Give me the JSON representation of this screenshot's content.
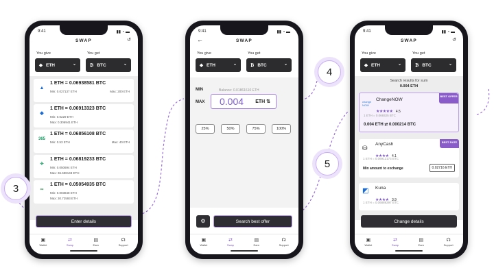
{
  "common": {
    "time": "9:41",
    "title": "SWAP",
    "you_give": "You give",
    "you_get": "You get",
    "give": "ETH",
    "get": "BTC",
    "nav": [
      {
        "icon": "wallet-icon",
        "label": "Wallet"
      },
      {
        "icon": "swap-icon",
        "label": "Swap"
      },
      {
        "icon": "earn-icon",
        "label": "Earn"
      },
      {
        "icon": "support-icon",
        "label": "Support"
      }
    ]
  },
  "screen1": {
    "offers": [
      {
        "logo": "▲",
        "rate": "1 ETH = 0.06938581 BTC",
        "min": "Min: 0.027137 ETH",
        "max": "Max: 200 ETH"
      },
      {
        "logo": "◆",
        "rate": "1 ETH = 0.06913323 BTC",
        "min": "Min: 0.0229 ETH",
        "max2": "Max: 0.306941 ETH"
      },
      {
        "logo": "365",
        "rate": "1 ETH = 0.06856108 BTC",
        "min": "Min: 0.53 ETH",
        "max": "Max: 40 ETH"
      },
      {
        "logo": "✈",
        "rate": "1 ETH = 0.06819233 BTC",
        "min": "Min: 0.050694 ETH",
        "max2": "Max: 36.698148 ETH"
      },
      {
        "logo": "∞",
        "rate": "1 ETH = 0.05054935 BTC",
        "min": "Min: 0.003848 ETH",
        "max2": "Max: 30.72593 ETH"
      }
    ],
    "button": "Enter details"
  },
  "screen2": {
    "min": "MIN",
    "max": "MAX",
    "balance": "Balance: 0.01861610 ETH",
    "amount": "0.004",
    "unit": "ETH ⇅",
    "pcts": [
      "25%",
      "50%",
      "75%",
      "100%"
    ],
    "button": "Search best offer"
  },
  "screen3": {
    "heading": "Search results for sum",
    "sum": "0.004 ETH",
    "r1": {
      "name": "ChangeNOW",
      "score": "4.5",
      "rate": "1 ETH = 0.069325 BTC",
      "conv": "0.004 ETH ⇄ 0.000214 BTC",
      "badge": "BEST OFFER"
    },
    "r2": {
      "name": "AnyCash",
      "score": "4.1",
      "rate": "1 ETH = 0.06912173 BTC",
      "badge": "BEST RATE",
      "minx": "Min amount to exchange",
      "minv": "0.02716 ETH"
    },
    "r3": {
      "name": "Kuna",
      "score": "3.9",
      "rate": "1 ETH = 0.06889297 BTC"
    },
    "button": "Change details"
  },
  "steps": {
    "s3": "3",
    "s4": "4",
    "s5": "5"
  },
  "colors": {
    "accent": "#8a5cc9",
    "dark": "#2c2c2e"
  }
}
